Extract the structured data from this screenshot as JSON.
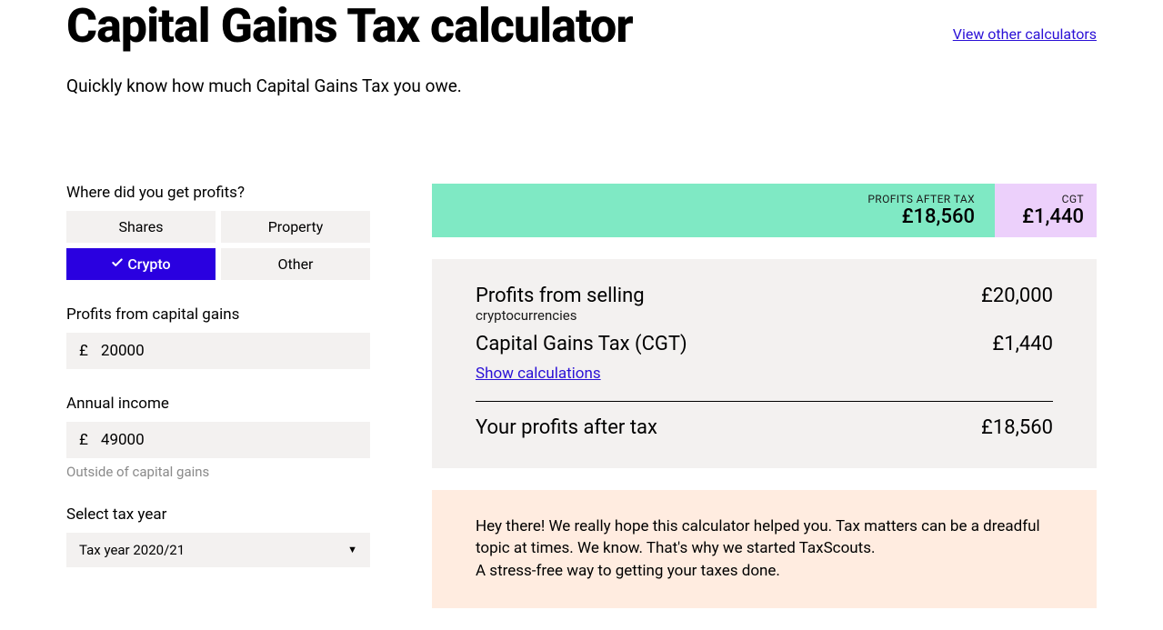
{
  "header": {
    "title": "Capital Gains Tax calculator",
    "other_link": "View other calculators",
    "subtitle": "Quickly know how much Capital Gains Tax you owe."
  },
  "form": {
    "profits_source_label": "Where did you get profits?",
    "options": {
      "shares": "Shares",
      "property": "Property",
      "crypto": "Crypto",
      "other": "Other"
    },
    "profits_label": "Profits from capital gains",
    "currency_symbol": "£",
    "profits_value": "20000",
    "income_label": "Annual income",
    "income_value": "49000",
    "income_helper": "Outside of capital gains",
    "year_label": "Select tax year",
    "year_value": "Tax year 2020/21"
  },
  "summary": {
    "left_label": "PROFITS AFTER TAX",
    "left_value": "£18,560",
    "right_label": "CGT",
    "right_value": "£1,440"
  },
  "results": {
    "row1_label": "Profits from selling",
    "row1_sub": "cryptocurrencies",
    "row1_val": "£20,000",
    "row2_label": "Capital Gains Tax (CGT)",
    "row2_val": "£1,440",
    "show_calc": "Show calculations",
    "row3_label": "Your profits after tax",
    "row3_val": "£18,560"
  },
  "promo": {
    "line1": "Hey there! We really hope this calculator helped you. Tax matters can be a dreadful topic at times. We know. That's why we started TaxScouts.",
    "line2": "A stress-free way to getting your taxes done."
  }
}
